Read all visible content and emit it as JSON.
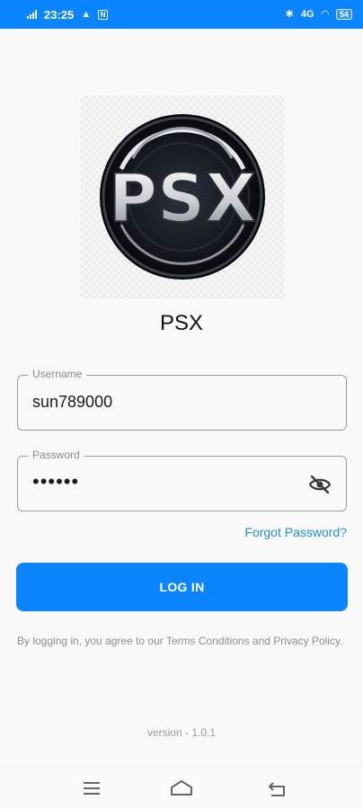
{
  "status_bar": {
    "time": "23:25",
    "battery": "54",
    "network": "4G"
  },
  "app": {
    "name": "PSX",
    "logo_text": "PSX"
  },
  "form": {
    "username": {
      "label": "Username",
      "value": "sun789000"
    },
    "password": {
      "label": "Password",
      "value": "••••••"
    },
    "forgot_password": "Forgot Password?",
    "login_button": "LOG IN"
  },
  "terms_text": "By logging in, you agree to our Terms  Conditions and Privacy Policy.",
  "version": "version - 1.0.1",
  "colors": {
    "accent": "#0a84ff",
    "link": "#1e90c8",
    "background": "#f9f9f9"
  },
  "icons": {
    "password_toggle": "eye-off-icon",
    "nav": [
      "menu-icon",
      "home-icon",
      "back-icon"
    ]
  }
}
